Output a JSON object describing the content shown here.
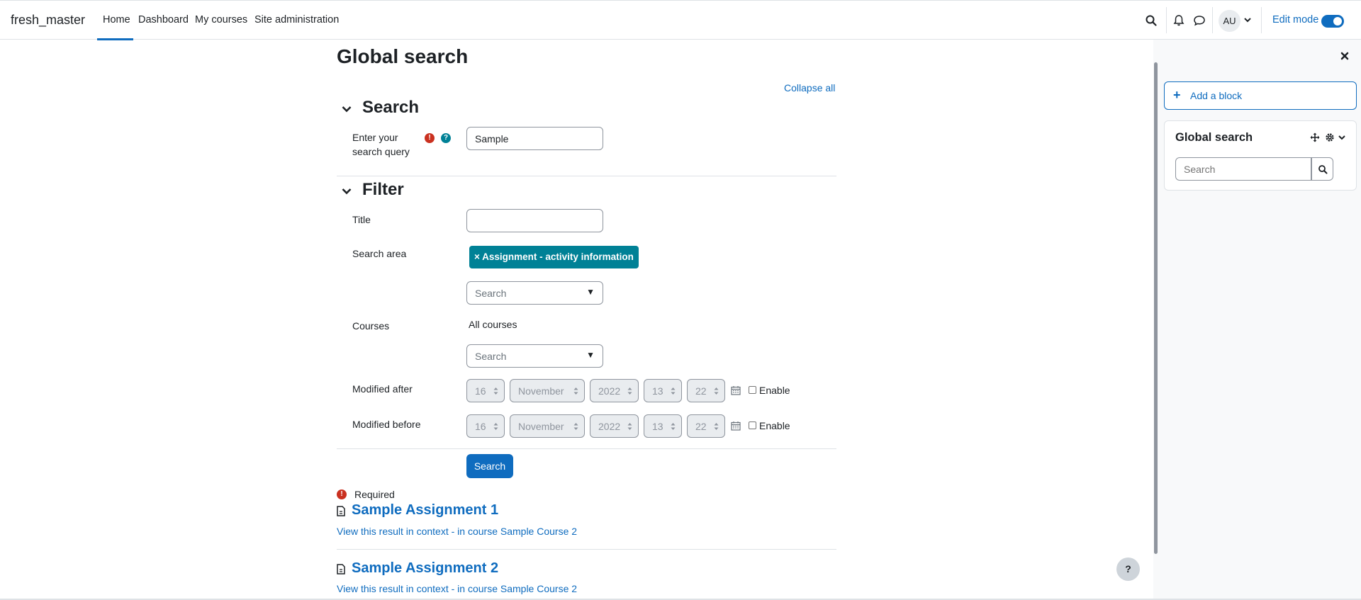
{
  "navbar": {
    "brand": "fresh_master",
    "links": [
      {
        "label": "Home"
      },
      {
        "label": "Dashboard"
      },
      {
        "label": "My courses"
      },
      {
        "label": "Site administration"
      }
    ],
    "avatar_initials": "AU",
    "edit_mode_label": "Edit mode",
    "edit_mode_on": true
  },
  "page": {
    "title": "Global search",
    "collapse_all": "Collapse all"
  },
  "search_section": {
    "title": "Search",
    "query_label": "Enter your search query",
    "query_value": "Sample"
  },
  "filter_section": {
    "title": "Filter",
    "title_label": "Title",
    "title_value": "",
    "area_label": "Search area",
    "area_tag": "× Assignment - activity information",
    "area_search_placeholder": "Search",
    "courses_label": "Courses",
    "courses_value": "All courses",
    "courses_search_placeholder": "Search",
    "modified_after_label": "Modified after",
    "modified_before_label": "Modified before",
    "date": {
      "day": "16",
      "month": "November",
      "year": "2022",
      "hour": "13",
      "minute": "22"
    },
    "enable_label": "Enable"
  },
  "submit_label": "Search",
  "required_label": "Required",
  "results": [
    {
      "title": "Sample Assignment 1",
      "context_link": "View this result in context",
      "separator": " - ",
      "course_link": "in course Sample Course 2"
    },
    {
      "title": "Sample Assignment 2",
      "context_link": "View this result in context",
      "separator": " - ",
      "course_link": "in course Sample Course 2"
    }
  ],
  "drawer": {
    "add_block": "Add a block",
    "block_title": "Global search",
    "block_search_placeholder": "Search"
  },
  "help_fab": "?",
  "colors": {
    "primary": "#0f6cbf",
    "tag": "#008196",
    "required": "#ca3120"
  }
}
